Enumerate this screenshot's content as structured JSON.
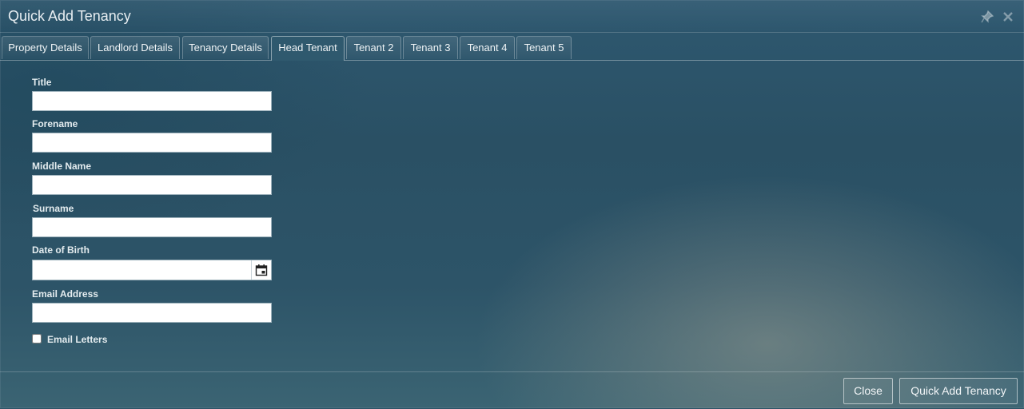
{
  "window": {
    "title": "Quick Add Tenancy"
  },
  "tabs": [
    {
      "label": "Property Details"
    },
    {
      "label": "Landlord Details"
    },
    {
      "label": "Tenancy Details"
    },
    {
      "label": "Head Tenant",
      "active": true
    },
    {
      "label": "Tenant 2"
    },
    {
      "label": "Tenant 3"
    },
    {
      "label": "Tenant 4"
    },
    {
      "label": "Tenant 5"
    }
  ],
  "form": {
    "title": {
      "label": "Title",
      "value": ""
    },
    "forename": {
      "label": "Forename",
      "value": ""
    },
    "middle_name": {
      "label": "Middle Name",
      "value": ""
    },
    "surname": {
      "label": "Surname",
      "value": ""
    },
    "dob": {
      "label": "Date of Birth",
      "value": ""
    },
    "email": {
      "label": "Email Address",
      "value": ""
    },
    "email_letters": {
      "label": "Email Letters",
      "checked": false
    }
  },
  "footer": {
    "close_label": "Close",
    "submit_label": "Quick Add Tenancy"
  },
  "icons": {
    "pin": "pin-icon",
    "close": "close-icon",
    "calendar": "calendar-icon"
  }
}
